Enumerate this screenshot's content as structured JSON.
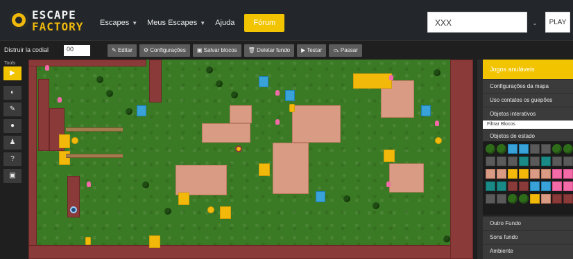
{
  "header": {
    "logo_line1": "ESCAPE",
    "logo_line2": "FACTORY",
    "nav": [
      {
        "label": "Escapes",
        "has_caret": true
      },
      {
        "label": "Meus Escapes",
        "has_caret": true
      },
      {
        "label": "Ajuda",
        "has_caret": false
      }
    ],
    "nav_highlight": "Fórum",
    "search_value": "XXX",
    "dash": "-",
    "play_label": "PLAY"
  },
  "toolbar": {
    "label": "Distruir la codial",
    "input_value": "00",
    "buttons": [
      {
        "label": "Editar",
        "icon": "edit-icon"
      },
      {
        "label": "Configurações",
        "icon": "gear-icon"
      },
      {
        "label": "Salvar blocos",
        "icon": "save-icon"
      },
      {
        "label": "Deletar fundo",
        "icon": "trash-icon"
      },
      {
        "label": "Testar",
        "icon": "play-icon"
      },
      {
        "label": "Passar",
        "icon": "skip-icon"
      }
    ]
  },
  "tools": {
    "title": "Tools",
    "items": [
      {
        "name": "pointer-tool",
        "glyph": "▶",
        "active": true
      },
      {
        "name": "layers-tool",
        "glyph": "◐",
        "active": false
      },
      {
        "name": "edit-tool",
        "glyph": "✎",
        "active": false
      },
      {
        "name": "marker-tool",
        "glyph": "●",
        "active": false
      },
      {
        "name": "person-tool",
        "glyph": "♟",
        "active": false
      },
      {
        "name": "help-tool",
        "glyph": "?",
        "active": false
      },
      {
        "name": "save-tool",
        "glyph": "▣",
        "active": false
      }
    ]
  },
  "sidebar": {
    "title": "Jogos anuláveis",
    "rows": [
      "Configurações da mapa",
      "Uso contatos os guepões",
      "Objetos interativos"
    ],
    "filter_placeholder": "Filtrar Blocos",
    "palette_title": "Objetos de estado",
    "bottom_rows": [
      "Outro Fundo",
      "Sons fundo",
      "Ambiente"
    ]
  },
  "colors": {
    "accent": "#f2c400",
    "map_grass": "#3b7a24",
    "wall": "#8b3a3a",
    "floor": "#d99b84",
    "gold": "#f3b90a",
    "blue": "#39a2d8"
  }
}
